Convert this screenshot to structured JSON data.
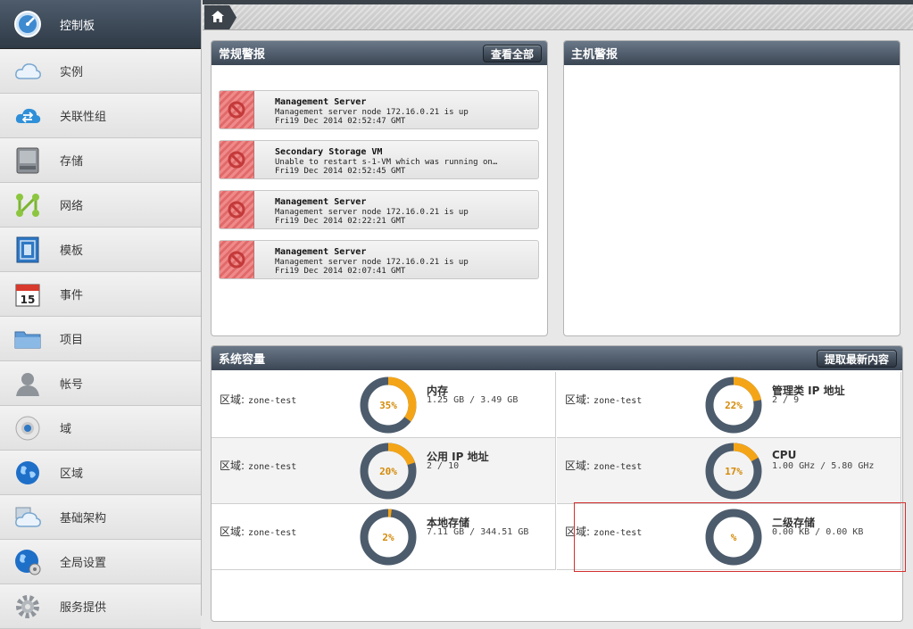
{
  "sidebar": {
    "items": [
      {
        "label": "控制板",
        "icon": "dashboard-icon",
        "active": true
      },
      {
        "label": "实例",
        "icon": "cloud-icon"
      },
      {
        "label": "关联性组",
        "icon": "affinity-group-icon"
      },
      {
        "label": "存储",
        "icon": "storage-icon"
      },
      {
        "label": "网络",
        "icon": "network-icon"
      },
      {
        "label": "模板",
        "icon": "template-icon"
      },
      {
        "label": "事件",
        "icon": "calendar-icon"
      },
      {
        "label": "项目",
        "icon": "folder-icon"
      },
      {
        "label": "帐号",
        "icon": "user-icon"
      },
      {
        "label": "域",
        "icon": "domain-icon"
      },
      {
        "label": "区域",
        "icon": "globe-icon"
      },
      {
        "label": "基础架构",
        "icon": "infrastructure-icon"
      },
      {
        "label": "全局设置",
        "icon": "global-settings-icon"
      },
      {
        "label": "服务提供",
        "icon": "gear-icon"
      }
    ]
  },
  "general_alerts": {
    "title": "常规警报",
    "view_all": "查看全部",
    "alerts": [
      {
        "title": "Management Server",
        "message": "Management server node 172.16.0.21 is up",
        "time": "Fri19 Dec 2014 02:52:47 GMT"
      },
      {
        "title": "Secondary Storage VM",
        "message": "Unable to restart s-1-VM which was running on…",
        "time": "Fri19 Dec 2014 02:52:45 GMT"
      },
      {
        "title": "Management Server",
        "message": "Management server node 172.16.0.21 is up",
        "time": "Fri19 Dec 2014 02:22:21 GMT"
      },
      {
        "title": "Management Server",
        "message": "Management server node 172.16.0.21 is up",
        "time": "Fri19 Dec 2014 02:07:41 GMT"
      }
    ]
  },
  "host_alerts": {
    "title": "主机警报"
  },
  "capacity": {
    "title": "系统容量",
    "refresh": "提取最新内容",
    "zone_label": "区域:",
    "cells": [
      {
        "zone": "zone-test",
        "name": "内存",
        "value": "1.25 GB / 3.49 GB",
        "percent_text": "35%",
        "fraction": 0.35
      },
      {
        "zone": "zone-test",
        "name": "管理类 IP 地址",
        "value": "2 / 9",
        "percent_text": "22%",
        "fraction": 0.22
      },
      {
        "zone": "zone-test",
        "name": "公用 IP 地址",
        "value": "2 / 10",
        "percent_text": "20%",
        "fraction": 0.2
      },
      {
        "zone": "zone-test",
        "name": "CPU",
        "value": "1.00 GHz / 5.80 GHz",
        "percent_text": "17%",
        "fraction": 0.17
      },
      {
        "zone": "zone-test",
        "name": "本地存储",
        "value": "7.11 GB / 344.51 GB",
        "percent_text": "2%",
        "fraction": 0.02
      },
      {
        "zone": "zone-test",
        "name": "二级存储",
        "value": "0.00 KB / 0.00 KB",
        "percent_text": "%",
        "fraction": 0
      }
    ]
  },
  "colors": {
    "donut_track": "#4d5c6c",
    "donut_fill": "#f4a517",
    "donut_text": "#d48a08"
  }
}
